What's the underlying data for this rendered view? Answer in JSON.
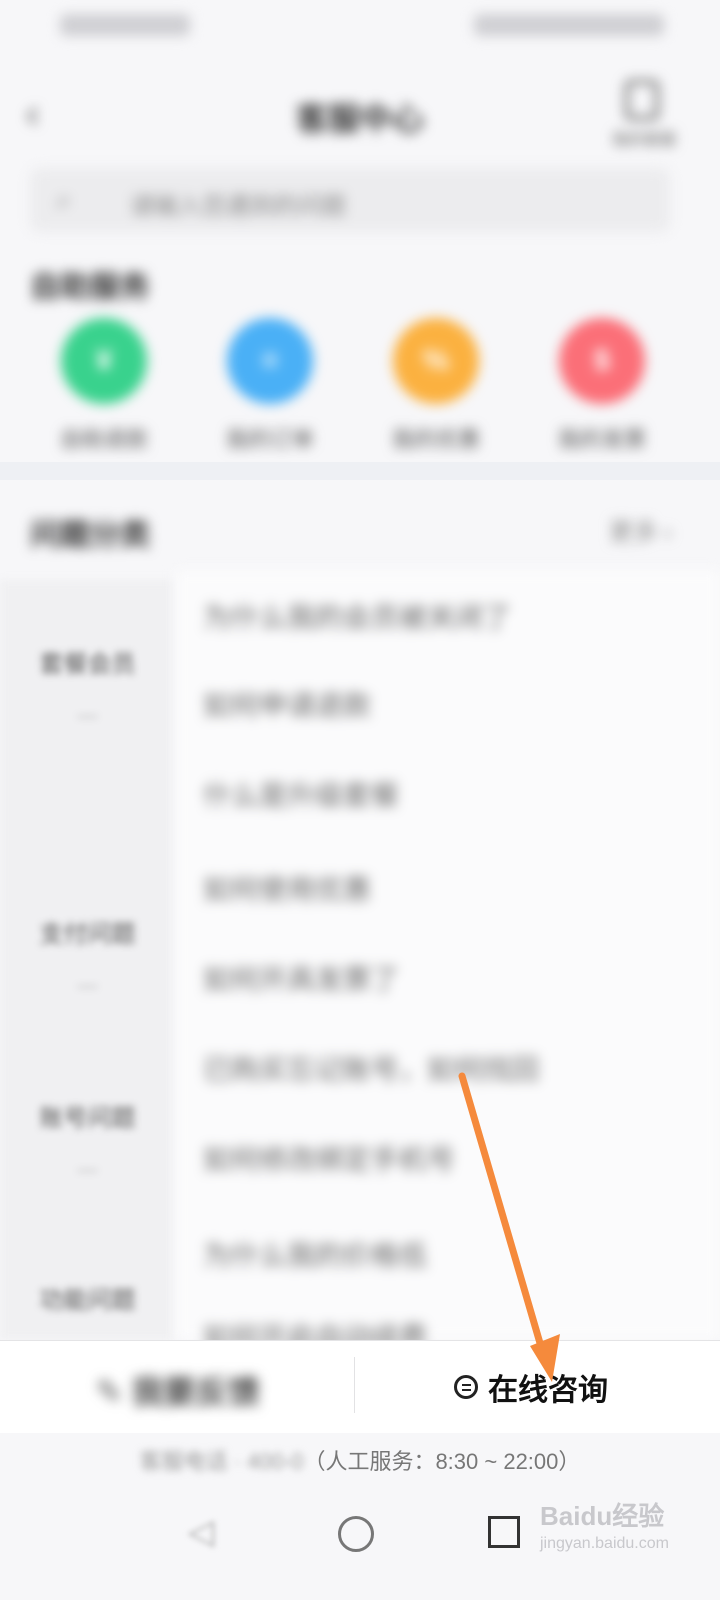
{
  "header": {
    "title": "客服中心",
    "icon_label": "我的客服"
  },
  "search": {
    "placeholder": "请输入您遇到的问题"
  },
  "self_service": {
    "title": "自助服务",
    "items": [
      {
        "label": "自助退款",
        "glyph": "¥",
        "color": "#39d28d"
      },
      {
        "label": "我的订单",
        "glyph": "≡",
        "color": "#4ab0f6"
      },
      {
        "label": "我的优惠",
        "glyph": "%",
        "color": "#fbb140"
      },
      {
        "label": "我的发票",
        "glyph": "$",
        "color": "#fb6f78"
      }
    ]
  },
  "problems": {
    "title": "问题分类",
    "more": "更多 ›",
    "categories": [
      "套餐会员",
      "支付问题",
      "账号问题",
      "功能问题"
    ],
    "questions": [
      "为什么我的会员被关闭了",
      "如何申请退款",
      "什么是升级套餐",
      "如何使用优惠",
      "如何开具发票了",
      "已购买忘记账号，如何找回",
      "如何修改绑定手机号",
      "为什么我的价格低",
      "如何开启自动续费"
    ]
  },
  "bottom_bar": {
    "feedback_label": "我要反馈",
    "consult_label": "在线咨询",
    "hours_blur": "客服电话 · 400-0",
    "hours_text": "（人工服务：8:30 ~ 22:00）"
  },
  "watermark": {
    "brand": "Baidu经验",
    "url": "jingyan.baidu.com"
  },
  "annotation_color": "#f58a3c"
}
